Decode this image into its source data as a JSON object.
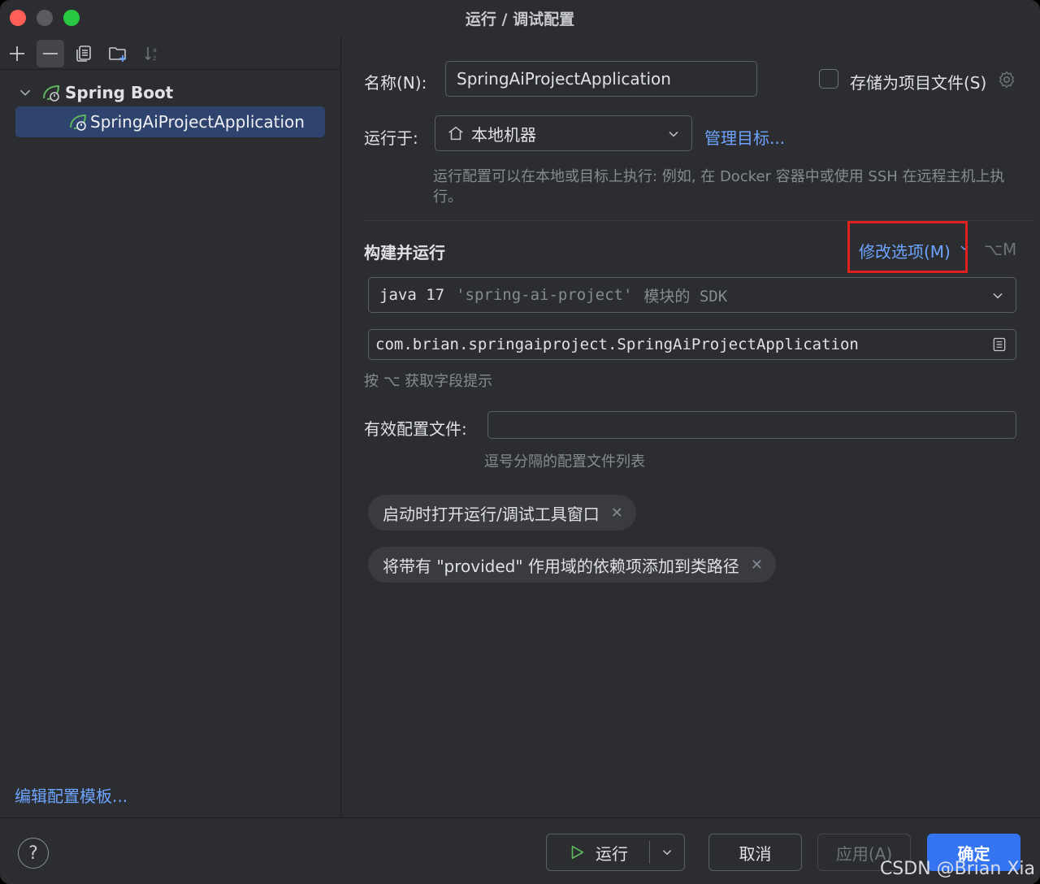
{
  "window": {
    "title": "运行 / 调试配置"
  },
  "sidebar": {
    "tree_group_label": "Spring Boot",
    "tree_item_label": "SpringAiProjectApplication",
    "edit_templates_link": "编辑配置模板..."
  },
  "form": {
    "name_label": "名称(N):",
    "name_value": "SpringAiProjectApplication",
    "store_as_project_file": "存储为项目文件(S)",
    "run_on_label": "运行于:",
    "run_on_value": "本地机器",
    "manage_targets_link": "管理目标...",
    "run_on_hint": "运行配置可以在本地或目标上执行: 例如, 在 Docker 容器中或使用 SSH 在远程主机上执行。",
    "build_run_title": "构建并运行",
    "modify_options_link": "修改选项(M)",
    "modify_options_shortcut": "⌥M",
    "sdk_java": "java 17",
    "sdk_module": "'spring-ai-project'",
    "sdk_suffix": "模块的 SDK",
    "main_class_value": "com.brian.springaiproject.SpringAiProjectApplication",
    "field_hint": "按 ⌥ 获取字段提示",
    "active_profiles_label": "有效配置文件:",
    "active_profiles_value": "",
    "active_profiles_hint": "逗号分隔的配置文件列表",
    "chips": [
      "启动时打开运行/调试工具窗口",
      "将带有 \"provided\" 作用域的依赖项添加到类路径"
    ]
  },
  "footer": {
    "help_label": "?",
    "run_button": "运行",
    "cancel_button": "取消",
    "apply_button": "应用(A)",
    "ok_button": "确定"
  },
  "watermark": "CSDN @Brian Xia",
  "colors": {
    "accent": "#3574f0",
    "link": "#6ea4ff",
    "highlight": "#e0201c",
    "selection": "#2e436e"
  }
}
